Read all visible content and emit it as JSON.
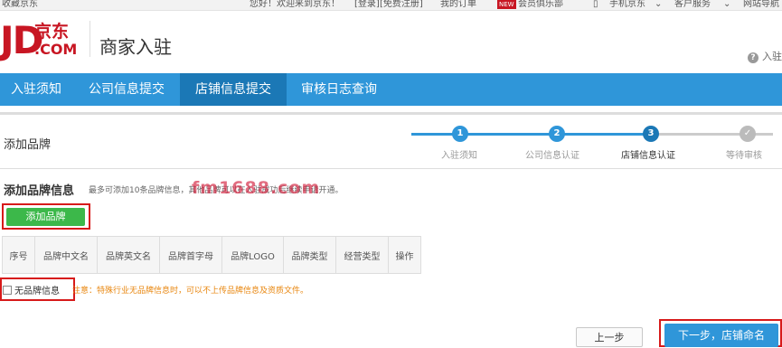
{
  "topbar": {
    "bookmark": "收藏京东",
    "welcome": "您好！欢迎来到京东！",
    "login": "[登录]",
    "register": "[免费注册]",
    "my_orders": "我的订单",
    "new_badge": "NEW",
    "vip": "会员俱乐部",
    "mobile": "手机京东",
    "service": "客户服务",
    "sitenav": "网站导航"
  },
  "header": {
    "logo_jd": "JD",
    "logo_cn": "京东",
    "logo_com": ".COM",
    "title": "商家入驻",
    "help": "入驻"
  },
  "nav": {
    "items": [
      {
        "label": "入驻须知",
        "active": false
      },
      {
        "label": "公司信息提交",
        "active": false
      },
      {
        "label": "店铺信息提交",
        "active": true
      },
      {
        "label": "审核日志查询",
        "active": false
      }
    ]
  },
  "section": {
    "title": "添加品牌"
  },
  "steps": [
    {
      "num": "1",
      "label": "入驻须知",
      "state": "done"
    },
    {
      "num": "2",
      "label": "公司信息认证",
      "state": "done"
    },
    {
      "num": "3",
      "label": "店铺信息认证",
      "state": "current"
    },
    {
      "num": "✓",
      "label": "等待审核",
      "state": "pending"
    }
  ],
  "brand_info": {
    "title": "添加品牌信息",
    "note": "最多可添加10条品牌信息，其他品牌可以在入驻成功后继续申请开通。",
    "watermark": "fm1688.com",
    "add_button": "添加品牌"
  },
  "table": {
    "headers": [
      "序号",
      "品牌中文名",
      "品牌英文名",
      "品牌首字母",
      "品牌LOGO",
      "品牌类型",
      "经营类型",
      "操作"
    ]
  },
  "no_brand": {
    "label": "无品牌信息",
    "warning": "注意：特殊行业无品牌信息时，可以不上传品牌信息及资质文件。"
  },
  "buttons": {
    "prev": "上一步",
    "next": "下一步，店铺命名"
  },
  "colors": {
    "brand_red": "#c81623",
    "nav_blue": "#2f96d9",
    "nav_active": "#1b78b6",
    "add_green": "#3cb84a",
    "warning_orange": "#e8860e",
    "highlight_red": "#d71a1a"
  }
}
